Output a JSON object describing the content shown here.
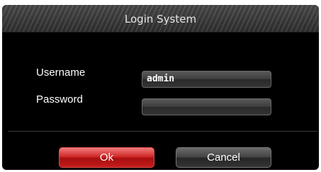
{
  "dialog": {
    "title": "Login System"
  },
  "form": {
    "username_label": "Username",
    "username_value": "admin",
    "password_label": "Password",
    "password_value": ""
  },
  "buttons": {
    "ok_label": "Ok",
    "cancel_label": "Cancel"
  },
  "colors": {
    "ok_button": "#d02a2a",
    "cancel_button": "#444444",
    "background": "#000000"
  }
}
